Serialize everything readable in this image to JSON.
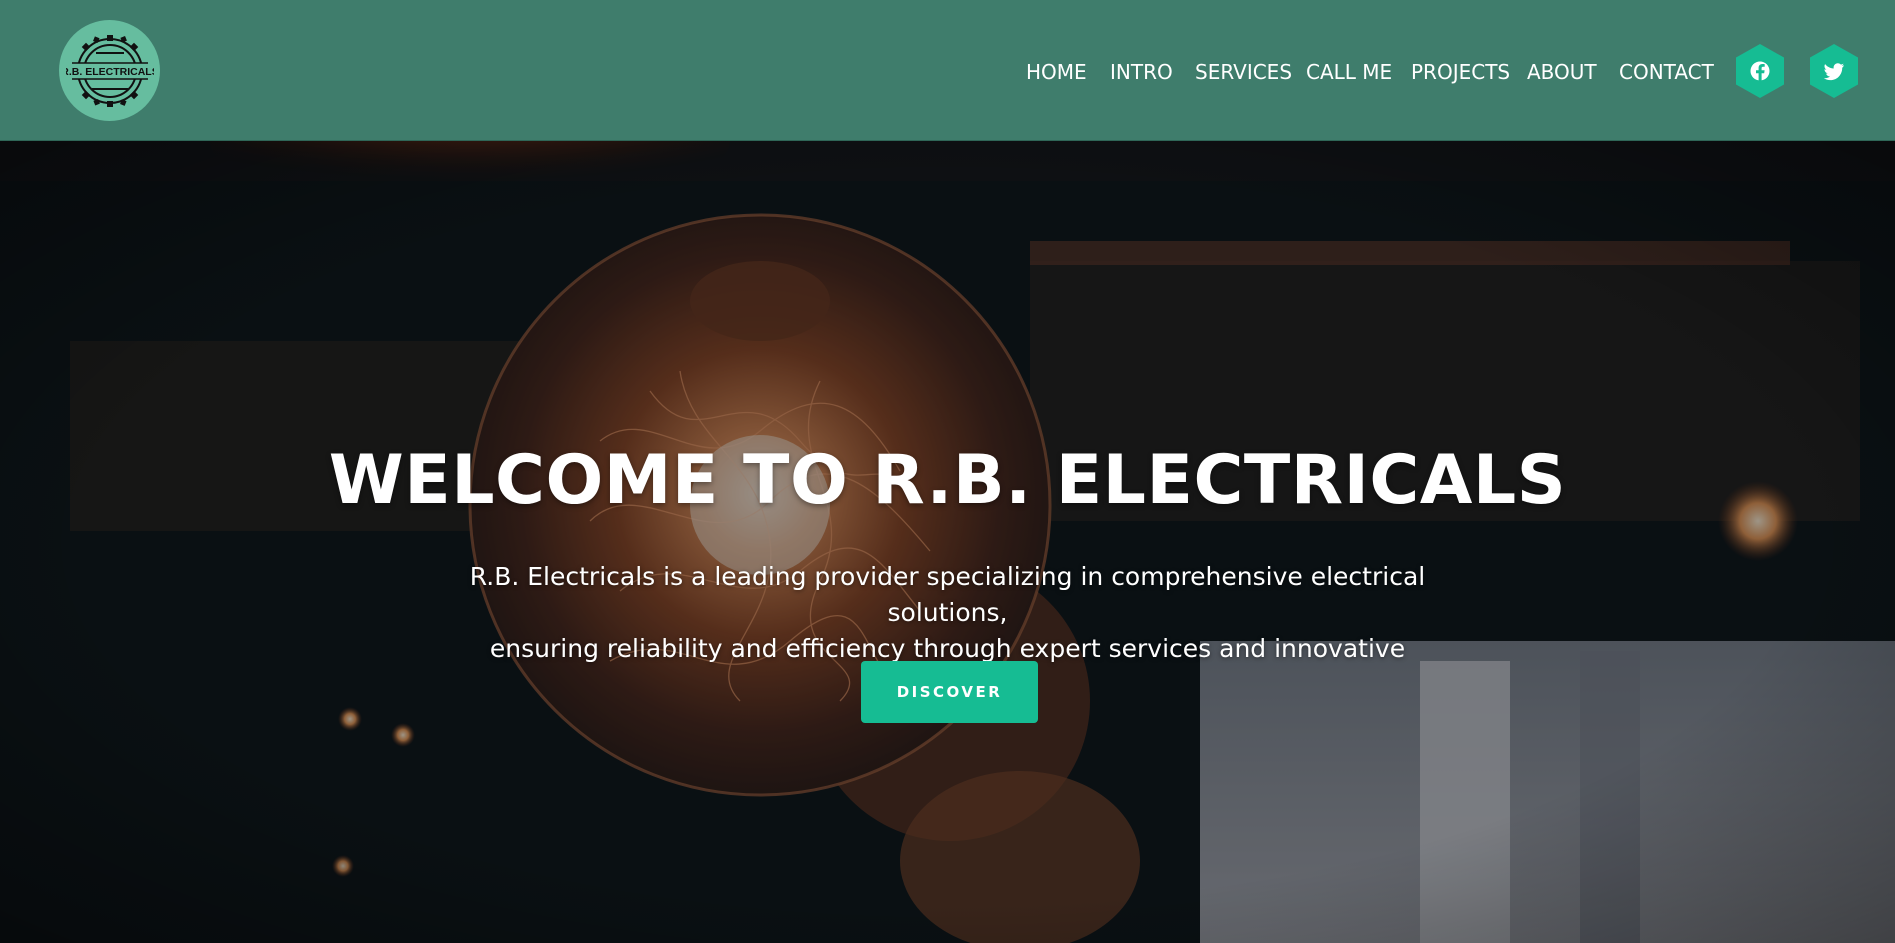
{
  "brand": {
    "logo_text": "R.B. ELECTRICALS",
    "logo_icon": "gear-badge-logo"
  },
  "nav": {
    "items": [
      {
        "label": "HOME"
      },
      {
        "label": "INTRO"
      },
      {
        "label": "SERVICES"
      },
      {
        "label": "CALL ME"
      },
      {
        "label": "PROJECTS"
      },
      {
        "label": "ABOUT"
      },
      {
        "label": "CONTACT"
      }
    ]
  },
  "social": {
    "facebook_icon": "facebook-icon",
    "twitter_icon": "twitter-icon"
  },
  "hero": {
    "title": "WELCOME TO R.B. ELECTRICALS",
    "line1": "R.B. Electricals is a leading provider specializing in comprehensive electrical solutions,",
    "line2": "ensuring reliability and efficiency through expert services and innovative approaches.",
    "button_label": "DISCOVER"
  },
  "colors": {
    "header_bg": "#3f7d6c",
    "logo_bg": "#66bd9f",
    "accent": "#16bc93",
    "text": "#ffffff"
  }
}
